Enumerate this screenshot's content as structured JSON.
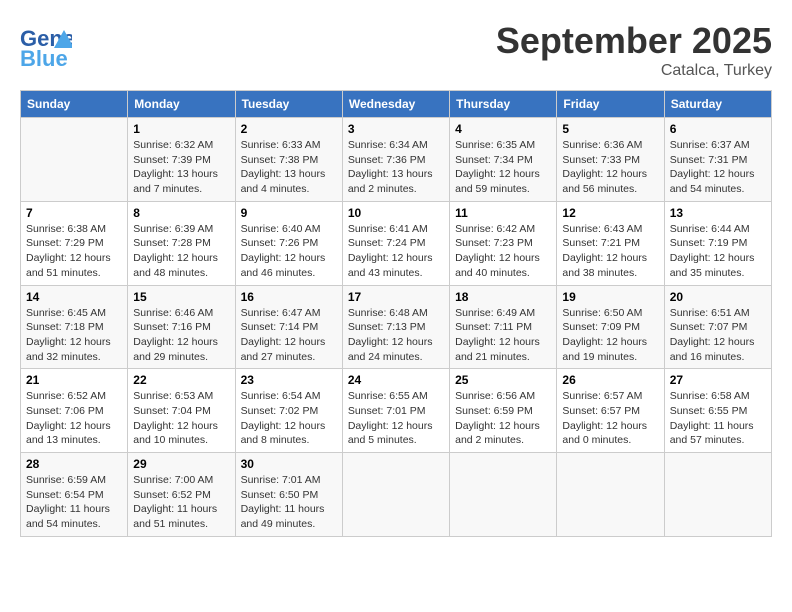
{
  "header": {
    "logo_line1": "General",
    "logo_line2": "Blue",
    "month": "September 2025",
    "location": "Catalca, Turkey"
  },
  "weekdays": [
    "Sunday",
    "Monday",
    "Tuesday",
    "Wednesday",
    "Thursday",
    "Friday",
    "Saturday"
  ],
  "weeks": [
    [
      {
        "day": "",
        "info": ""
      },
      {
        "day": "1",
        "info": "Sunrise: 6:32 AM\nSunset: 7:39 PM\nDaylight: 13 hours\nand 7 minutes."
      },
      {
        "day": "2",
        "info": "Sunrise: 6:33 AM\nSunset: 7:38 PM\nDaylight: 13 hours\nand 4 minutes."
      },
      {
        "day": "3",
        "info": "Sunrise: 6:34 AM\nSunset: 7:36 PM\nDaylight: 13 hours\nand 2 minutes."
      },
      {
        "day": "4",
        "info": "Sunrise: 6:35 AM\nSunset: 7:34 PM\nDaylight: 12 hours\nand 59 minutes."
      },
      {
        "day": "5",
        "info": "Sunrise: 6:36 AM\nSunset: 7:33 PM\nDaylight: 12 hours\nand 56 minutes."
      },
      {
        "day": "6",
        "info": "Sunrise: 6:37 AM\nSunset: 7:31 PM\nDaylight: 12 hours\nand 54 minutes."
      }
    ],
    [
      {
        "day": "7",
        "info": "Sunrise: 6:38 AM\nSunset: 7:29 PM\nDaylight: 12 hours\nand 51 minutes."
      },
      {
        "day": "8",
        "info": "Sunrise: 6:39 AM\nSunset: 7:28 PM\nDaylight: 12 hours\nand 48 minutes."
      },
      {
        "day": "9",
        "info": "Sunrise: 6:40 AM\nSunset: 7:26 PM\nDaylight: 12 hours\nand 46 minutes."
      },
      {
        "day": "10",
        "info": "Sunrise: 6:41 AM\nSunset: 7:24 PM\nDaylight: 12 hours\nand 43 minutes."
      },
      {
        "day": "11",
        "info": "Sunrise: 6:42 AM\nSunset: 7:23 PM\nDaylight: 12 hours\nand 40 minutes."
      },
      {
        "day": "12",
        "info": "Sunrise: 6:43 AM\nSunset: 7:21 PM\nDaylight: 12 hours\nand 38 minutes."
      },
      {
        "day": "13",
        "info": "Sunrise: 6:44 AM\nSunset: 7:19 PM\nDaylight: 12 hours\nand 35 minutes."
      }
    ],
    [
      {
        "day": "14",
        "info": "Sunrise: 6:45 AM\nSunset: 7:18 PM\nDaylight: 12 hours\nand 32 minutes."
      },
      {
        "day": "15",
        "info": "Sunrise: 6:46 AM\nSunset: 7:16 PM\nDaylight: 12 hours\nand 29 minutes."
      },
      {
        "day": "16",
        "info": "Sunrise: 6:47 AM\nSunset: 7:14 PM\nDaylight: 12 hours\nand 27 minutes."
      },
      {
        "day": "17",
        "info": "Sunrise: 6:48 AM\nSunset: 7:13 PM\nDaylight: 12 hours\nand 24 minutes."
      },
      {
        "day": "18",
        "info": "Sunrise: 6:49 AM\nSunset: 7:11 PM\nDaylight: 12 hours\nand 21 minutes."
      },
      {
        "day": "19",
        "info": "Sunrise: 6:50 AM\nSunset: 7:09 PM\nDaylight: 12 hours\nand 19 minutes."
      },
      {
        "day": "20",
        "info": "Sunrise: 6:51 AM\nSunset: 7:07 PM\nDaylight: 12 hours\nand 16 minutes."
      }
    ],
    [
      {
        "day": "21",
        "info": "Sunrise: 6:52 AM\nSunset: 7:06 PM\nDaylight: 12 hours\nand 13 minutes."
      },
      {
        "day": "22",
        "info": "Sunrise: 6:53 AM\nSunset: 7:04 PM\nDaylight: 12 hours\nand 10 minutes."
      },
      {
        "day": "23",
        "info": "Sunrise: 6:54 AM\nSunset: 7:02 PM\nDaylight: 12 hours\nand 8 minutes."
      },
      {
        "day": "24",
        "info": "Sunrise: 6:55 AM\nSunset: 7:01 PM\nDaylight: 12 hours\nand 5 minutes."
      },
      {
        "day": "25",
        "info": "Sunrise: 6:56 AM\nSunset: 6:59 PM\nDaylight: 12 hours\nand 2 minutes."
      },
      {
        "day": "26",
        "info": "Sunrise: 6:57 AM\nSunset: 6:57 PM\nDaylight: 12 hours\nand 0 minutes."
      },
      {
        "day": "27",
        "info": "Sunrise: 6:58 AM\nSunset: 6:55 PM\nDaylight: 11 hours\nand 57 minutes."
      }
    ],
    [
      {
        "day": "28",
        "info": "Sunrise: 6:59 AM\nSunset: 6:54 PM\nDaylight: 11 hours\nand 54 minutes."
      },
      {
        "day": "29",
        "info": "Sunrise: 7:00 AM\nSunset: 6:52 PM\nDaylight: 11 hours\nand 51 minutes."
      },
      {
        "day": "30",
        "info": "Sunrise: 7:01 AM\nSunset: 6:50 PM\nDaylight: 11 hours\nand 49 minutes."
      },
      {
        "day": "",
        "info": ""
      },
      {
        "day": "",
        "info": ""
      },
      {
        "day": "",
        "info": ""
      },
      {
        "day": "",
        "info": ""
      }
    ]
  ]
}
